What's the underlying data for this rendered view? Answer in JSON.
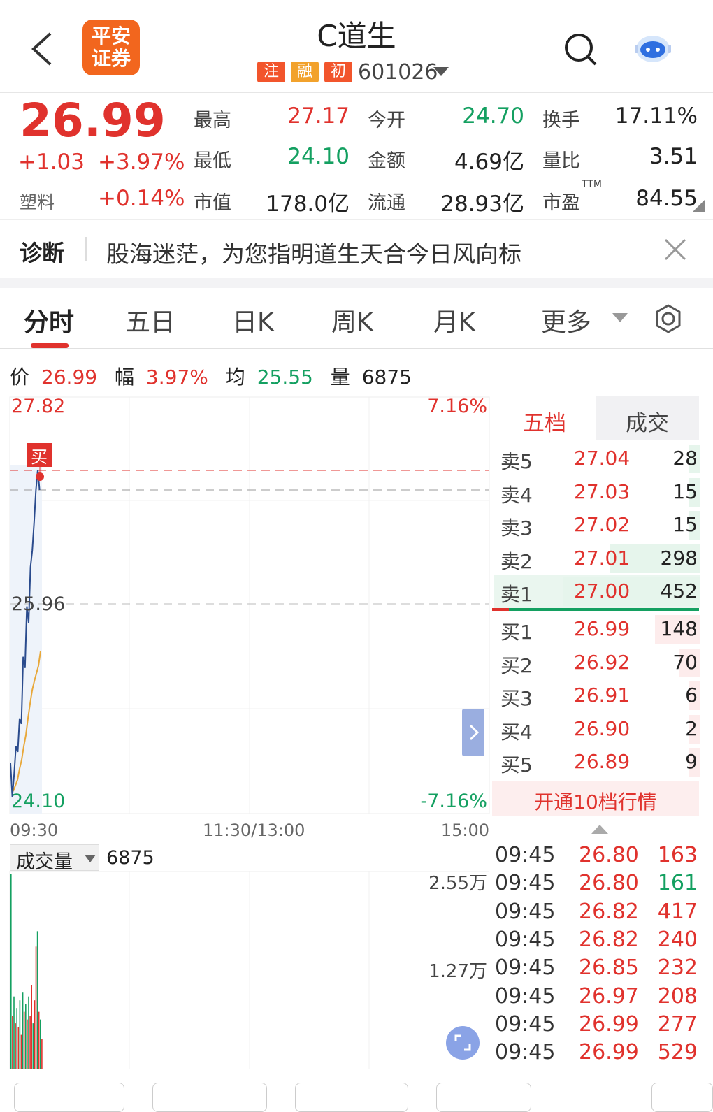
{
  "header": {
    "back_icon": "chevron-left-icon",
    "logo_line1": "平安",
    "logo_line2": "证券",
    "title": "C道生",
    "badges": [
      "注",
      "融",
      "初"
    ],
    "code": "601026",
    "search_icon": "search-icon",
    "robot_icon": "robot-icon"
  },
  "quote": {
    "price": "26.99",
    "change": "+1.03",
    "change_pct": "+3.97%",
    "sector": "塑料",
    "sector_pct": "+0.14%",
    "high_label": "最高",
    "high": "27.17",
    "low_label": "最低",
    "low": "24.10",
    "mcap_label": "市值",
    "mcap": "178.0亿",
    "open_label": "今开",
    "open": "24.70",
    "amount_label": "金额",
    "amount": "4.69亿",
    "float_label": "流通",
    "float": "28.93亿",
    "turnover_label": "换手",
    "turnover": "17.11%",
    "vol_ratio_label": "量比",
    "vol_ratio": "3.51",
    "pe_label": "市盈",
    "pe_sup": "TTM",
    "pe": "84.55"
  },
  "diagnosis": {
    "label": "诊断",
    "text": "股海迷茫，为您指明道生天合今日风向标",
    "close_icon": "close-icon"
  },
  "tabs": [
    {
      "label": "分时",
      "active": true
    },
    {
      "label": "五日"
    },
    {
      "label": "日K"
    },
    {
      "label": "周K"
    },
    {
      "label": "月K"
    },
    {
      "label": "更多"
    }
  ],
  "settings_icon": "gear-icon",
  "chart_info": {
    "price_label": "价",
    "price": "26.99",
    "amp_label": "幅",
    "amp": "3.97%",
    "avg_label": "均",
    "avg": "25.55",
    "vol_label": "量",
    "vol": "6875"
  },
  "chart_data": {
    "type": "line",
    "y_top": "27.82",
    "y_mid": "25.96",
    "y_bottom": "24.10",
    "pct_top": "7.16%",
    "pct_bottom": "-7.16%",
    "x_ticks": [
      "09:30",
      "11:30/13:00",
      "15:00"
    ],
    "ylim": [
      24.1,
      27.82
    ],
    "buy_marker": "买",
    "series": [
      {
        "values": [
          24.55,
          24.25,
          24.45,
          24.7,
          24.65,
          24.95,
          24.9,
          25.5,
          25.4,
          25.95,
          25.8,
          26.3,
          26.45,
          26.7,
          26.99,
          27.17,
          26.99
        ]
      },
      {
        "values": [
          24.3,
          24.35,
          24.4,
          24.5,
          24.58,
          24.7,
          24.8,
          24.95,
          25.08,
          25.2,
          25.28,
          25.35,
          25.42,
          25.55
        ]
      }
    ],
    "volume": {
      "label": "成交量",
      "value": "6875",
      "y_top": "2.55万",
      "y_mid": "1.27万",
      "bars": [
        25500,
        7000,
        9500,
        6000,
        8000,
        5500,
        9000,
        4500,
        10000,
        7500,
        8500,
        6500,
        9500,
        7000,
        11000,
        6000,
        9000,
        16000,
        18000,
        7500,
        6500,
        4000
      ],
      "bar_colors": [
        "g",
        "r",
        "g",
        "r",
        "g",
        "r",
        "g",
        "r",
        "g",
        "r",
        "g",
        "r",
        "g",
        "r",
        "r",
        "g",
        "r",
        "r",
        "g",
        "r",
        "g",
        "r"
      ],
      "ylim": [
        0,
        25500
      ]
    }
  },
  "order_book": {
    "tab_active": "五档",
    "tab_other": "成交",
    "sell": [
      {
        "label": "卖5",
        "price": "27.04",
        "qty": "28",
        "pct": 0.06
      },
      {
        "label": "卖4",
        "price": "27.03",
        "qty": "15",
        "pct": 0.03
      },
      {
        "label": "卖3",
        "price": "27.02",
        "qty": "15",
        "pct": 0.03
      },
      {
        "label": "卖2",
        "price": "27.01",
        "qty": "298",
        "pct": 0.66
      },
      {
        "label": "卖1",
        "price": "27.00",
        "qty": "452",
        "pct": 1.0
      }
    ],
    "buy": [
      {
        "label": "买1",
        "price": "26.99",
        "qty": "148",
        "pct": 0.33
      },
      {
        "label": "买2",
        "price": "26.92",
        "qty": "70",
        "pct": 0.16
      },
      {
        "label": "买3",
        "price": "26.91",
        "qty": "6",
        "pct": 0.02
      },
      {
        "label": "买4",
        "price": "26.90",
        "qty": "2",
        "pct": 0.01
      },
      {
        "label": "买5",
        "price": "26.89",
        "qty": "9",
        "pct": 0.02
      }
    ],
    "open_10": "开通10档行情"
  },
  "ticks": [
    {
      "time": "09:45",
      "price": "26.80",
      "qty": "163",
      "c": "red"
    },
    {
      "time": "09:45",
      "price": "26.80",
      "qty": "161",
      "c": "green"
    },
    {
      "time": "09:45",
      "price": "26.82",
      "qty": "417",
      "c": "red"
    },
    {
      "time": "09:45",
      "price": "26.82",
      "qty": "240",
      "c": "red"
    },
    {
      "time": "09:45",
      "price": "26.85",
      "qty": "232",
      "c": "red"
    },
    {
      "time": "09:45",
      "price": "26.97",
      "qty": "208",
      "c": "red"
    },
    {
      "time": "09:45",
      "price": "26.99",
      "qty": "277",
      "c": "red"
    },
    {
      "time": "09:45",
      "price": "26.99",
      "qty": "529",
      "c": "red"
    }
  ],
  "colors": {
    "up": "#e0322d",
    "down": "#14a061",
    "avg": "#e8a83a",
    "line": "#2a4b8d"
  }
}
